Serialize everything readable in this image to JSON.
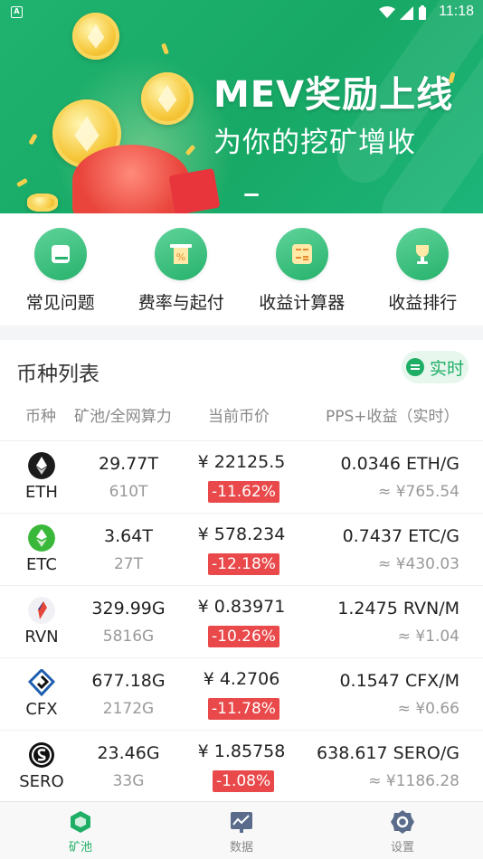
{
  "status_bar": {
    "time": "11:18",
    "app_icon_letter": "A"
  },
  "banner": {
    "title": "MEV奖励上线",
    "subtitle": "为你的挖矿增收"
  },
  "quick_menu": [
    {
      "label": "常见问题",
      "icon": "book-icon"
    },
    {
      "label": "费率与起付",
      "icon": "percent-receipt-icon"
    },
    {
      "label": "收益计算器",
      "icon": "calculator-icon"
    },
    {
      "label": "收益排行",
      "icon": "trophy-icon"
    }
  ],
  "coin_list": {
    "title": "币种列表",
    "realtime_label": "实时",
    "columns": [
      "币种",
      "矿池/全网算力",
      "当前币价",
      "PPS+收益（实时）"
    ],
    "rows": [
      {
        "symbol": "ETH",
        "icon": "eth-icon",
        "pool_hash": "29.77T",
        "net_hash": "610T",
        "price": "¥ 22125.5",
        "change": "-11.62%",
        "earn": "0.0346 ETH/G",
        "earn_cny": "≈ ¥765.54"
      },
      {
        "symbol": "ETC",
        "icon": "etc-icon",
        "pool_hash": "3.64T",
        "net_hash": "27T",
        "price": "¥ 578.234",
        "change": "-12.18%",
        "earn": "0.7437 ETC/G",
        "earn_cny": "≈ ¥430.03"
      },
      {
        "symbol": "RVN",
        "icon": "rvn-icon",
        "pool_hash": "329.99G",
        "net_hash": "5816G",
        "price": "¥ 0.83971",
        "change": "-10.26%",
        "earn": "1.2475 RVN/M",
        "earn_cny": "≈ ¥1.04"
      },
      {
        "symbol": "CFX",
        "icon": "cfx-icon",
        "pool_hash": "677.18G",
        "net_hash": "2172G",
        "price": "¥ 4.2706",
        "change": "-11.78%",
        "earn": "0.1547 CFX/M",
        "earn_cny": "≈ ¥0.66"
      },
      {
        "symbol": "SERO",
        "icon": "sero-icon",
        "pool_hash": "23.46G",
        "net_hash": "33G",
        "price": "¥ 1.85758",
        "change": "-1.08%",
        "earn": "638.617 SERO/G",
        "earn_cny": "≈ ¥1186.28"
      }
    ]
  },
  "tabbar": [
    {
      "label": "矿池",
      "icon": "pool-cube-icon",
      "active": true
    },
    {
      "label": "数据",
      "icon": "chart-icon",
      "active": false
    },
    {
      "label": "设置",
      "icon": "settings-icon",
      "active": false
    }
  ],
  "colors": {
    "brand_green": "#1fae66",
    "down_red": "#e9494a"
  }
}
